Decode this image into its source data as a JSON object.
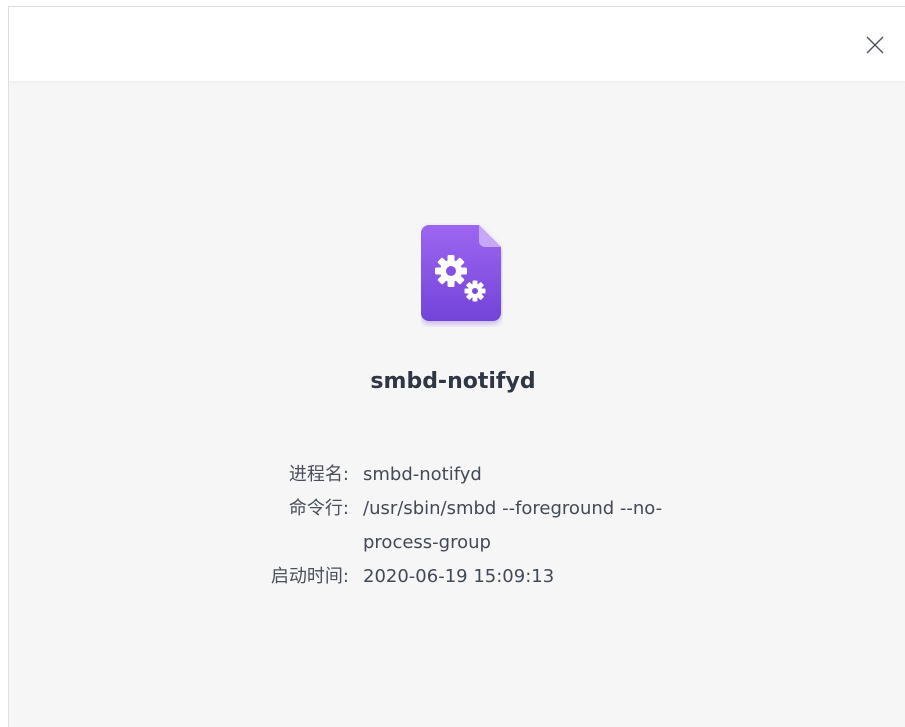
{
  "dialog": {
    "process_title": "smbd-notifyd",
    "icon": "gear-document-icon",
    "accent_color": "#8a52e6",
    "fields": [
      {
        "label": "进程名:",
        "value": "smbd-notifyd"
      },
      {
        "label": "命令行:",
        "value": "/usr/sbin/smbd --foreground --no-process-group"
      },
      {
        "label": "启动时间:",
        "value": "2020-06-19 15:09:13"
      }
    ]
  }
}
